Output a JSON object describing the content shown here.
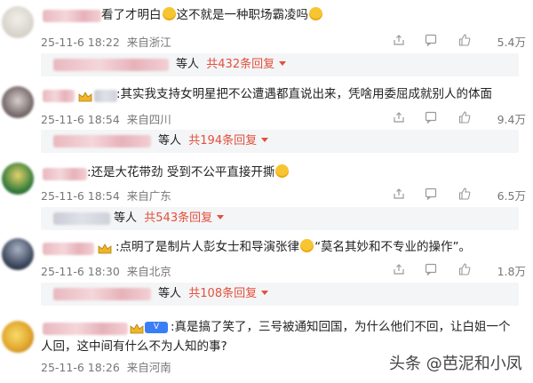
{
  "comments": [
    {
      "text_parts": [
        "看了才明白",
        "这不就是一种职场霸凌吗",
        ""
      ],
      "time": "25-11-6 18:22",
      "location": "来自浙江",
      "likes": "5.4万",
      "replies": {
        "suffix": "等人",
        "count": "共432条回复"
      }
    },
    {
      "text": ":其实我支持女明星把不公遭遇都直说出来，凭啥用委屈成就别人的体面",
      "time": "25-11-6 18:54",
      "location": "来自四川",
      "likes": "9.4万",
      "replies": {
        "suffix": "等人",
        "count": "共194条回复"
      }
    },
    {
      "text": ":还是大花带劲 受到不公平直接开撕",
      "time": "25-11-6 18:54",
      "location": "来自广东",
      "likes": "6.5万",
      "replies": {
        "suffix": "等人",
        "count": "共543条回复"
      }
    },
    {
      "text": ":点明了是制片人彭女士和导演张律",
      "text_after": "“莫名其妙和不专业的操作”。",
      "time": "25-11-6 18:30",
      "location": "来自北京",
      "likes": "1.8万",
      "replies": {
        "suffix": "等人",
        "count": "共108条回复"
      }
    },
    {
      "text": ":真是搞了笑了，三号被通知回国，为什么他们不回，让白姐一个人回，这中间有什么不为人知的事?",
      "time": "25-11-6 18:26",
      "location": "来自河南"
    }
  ],
  "watermark": {
    "source": "头条",
    "at": "@",
    "name": "芭泥和小凤"
  },
  "colors": {
    "reply_count": "#e2503d",
    "meta": "#777777",
    "reply_bg": "#f4f5f6"
  }
}
